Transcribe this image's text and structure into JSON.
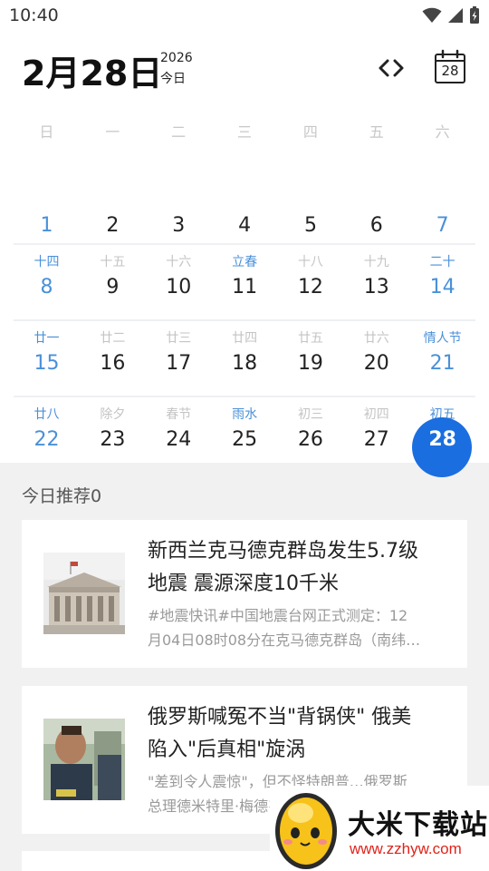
{
  "status_bar": {
    "time": "10:40"
  },
  "header": {
    "date_label": "2月28日",
    "year": "2026",
    "today_label": "今日",
    "calendar_icon_day": "28"
  },
  "weekdays": [
    "日",
    "一",
    "二",
    "三",
    "四",
    "五",
    "六"
  ],
  "calendar": {
    "rows": [
      [
        {
          "day": "1",
          "lunar": "",
          "weekend": true
        },
        {
          "day": "2",
          "lunar": ""
        },
        {
          "day": "3",
          "lunar": ""
        },
        {
          "day": "4",
          "lunar": ""
        },
        {
          "day": "5",
          "lunar": ""
        },
        {
          "day": "6",
          "lunar": ""
        },
        {
          "day": "7",
          "lunar": "",
          "weekend": true
        }
      ],
      [
        {
          "day": "8",
          "lunar": "十四",
          "weekend": true,
          "lunar_blue": true
        },
        {
          "day": "9",
          "lunar": "十五"
        },
        {
          "day": "10",
          "lunar": "十六"
        },
        {
          "day": "11",
          "lunar": "立春",
          "lunar_blue": true
        },
        {
          "day": "12",
          "lunar": "十八"
        },
        {
          "day": "13",
          "lunar": "十九"
        },
        {
          "day": "14",
          "lunar": "二十",
          "weekend": true,
          "lunar_blue": true
        }
      ],
      [
        {
          "day": "15",
          "lunar": "廿一",
          "weekend": true,
          "lunar_blue": true
        },
        {
          "day": "16",
          "lunar": "廿二"
        },
        {
          "day": "17",
          "lunar": "廿三"
        },
        {
          "day": "18",
          "lunar": "廿四"
        },
        {
          "day": "19",
          "lunar": "廿五"
        },
        {
          "day": "20",
          "lunar": "廿六"
        },
        {
          "day": "21",
          "lunar": "情人节",
          "weekend": true,
          "lunar_blue": true
        }
      ],
      [
        {
          "day": "22",
          "lunar": "廿八",
          "weekend": true,
          "lunar_blue": true
        },
        {
          "day": "23",
          "lunar": "除夕"
        },
        {
          "day": "24",
          "lunar": "春节"
        },
        {
          "day": "25",
          "lunar": "雨水",
          "lunar_blue": true
        },
        {
          "day": "26",
          "lunar": "初三"
        },
        {
          "day": "27",
          "lunar": "初四"
        },
        {
          "day": "28",
          "lunar": "初五",
          "weekend": true,
          "lunar_blue": true,
          "selected": true
        }
      ]
    ]
  },
  "recommend": {
    "title": "今日推荐0",
    "items": [
      {
        "headline_line1": "新西兰克马德克群岛发生5.7级",
        "headline_line2": "地震 震源深度10千米",
        "summary_line1": "#地震快讯#中国地震台网正式测定：12",
        "summary_line2": "月04日08时08分在克马德克群岛（南纬…"
      },
      {
        "headline_line1": "俄罗斯喊冤不当\"背锅侠\" 俄美",
        "headline_line2": "陷入\"后真相\"旋涡",
        "summary_line1": "\"差到令人震惊\"，但不怪特朗普…俄罗斯",
        "summary_line2": "总理德米特里·梅德韦杰夫…"
      }
    ]
  },
  "watermark": {
    "name": "大米下载站",
    "url": "www.zzhyw.com"
  },
  "colors": {
    "accent_blue": "#1a6ee0",
    "weekend_blue": "#4a90d9",
    "watermark_red": "#e0231b"
  }
}
